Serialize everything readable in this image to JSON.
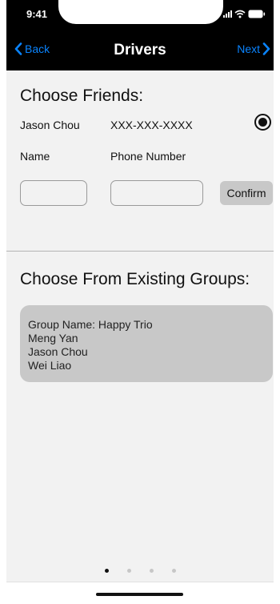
{
  "status_bar": {
    "time": "9:41"
  },
  "nav": {
    "back_label": "Back",
    "title": "Drivers",
    "next_label": "Next"
  },
  "friends": {
    "title": "Choose Friends:",
    "entry": {
      "name": "Jason Chou",
      "phone": "XXX-XXX-XXXX",
      "selected": true
    },
    "name_label": "Name",
    "phone_label": "Phone Number",
    "name_value": "",
    "phone_value": "",
    "confirm_label": "Confirm"
  },
  "groups": {
    "title": "Choose From Existing Groups:",
    "card": {
      "heading": "Group Name: Happy Trio",
      "members": [
        "Meng Yan",
        "Jason Chou",
        "Wei Liao"
      ]
    }
  },
  "pagination": {
    "total": 4,
    "current": 1
  },
  "colors": {
    "accent": "#0a84ff",
    "header": "#000000",
    "card": "#c8c8c8",
    "background": "#f2f2f2"
  },
  "icons": {
    "back": "chevron-left-icon",
    "next": "chevron-right-icon"
  }
}
